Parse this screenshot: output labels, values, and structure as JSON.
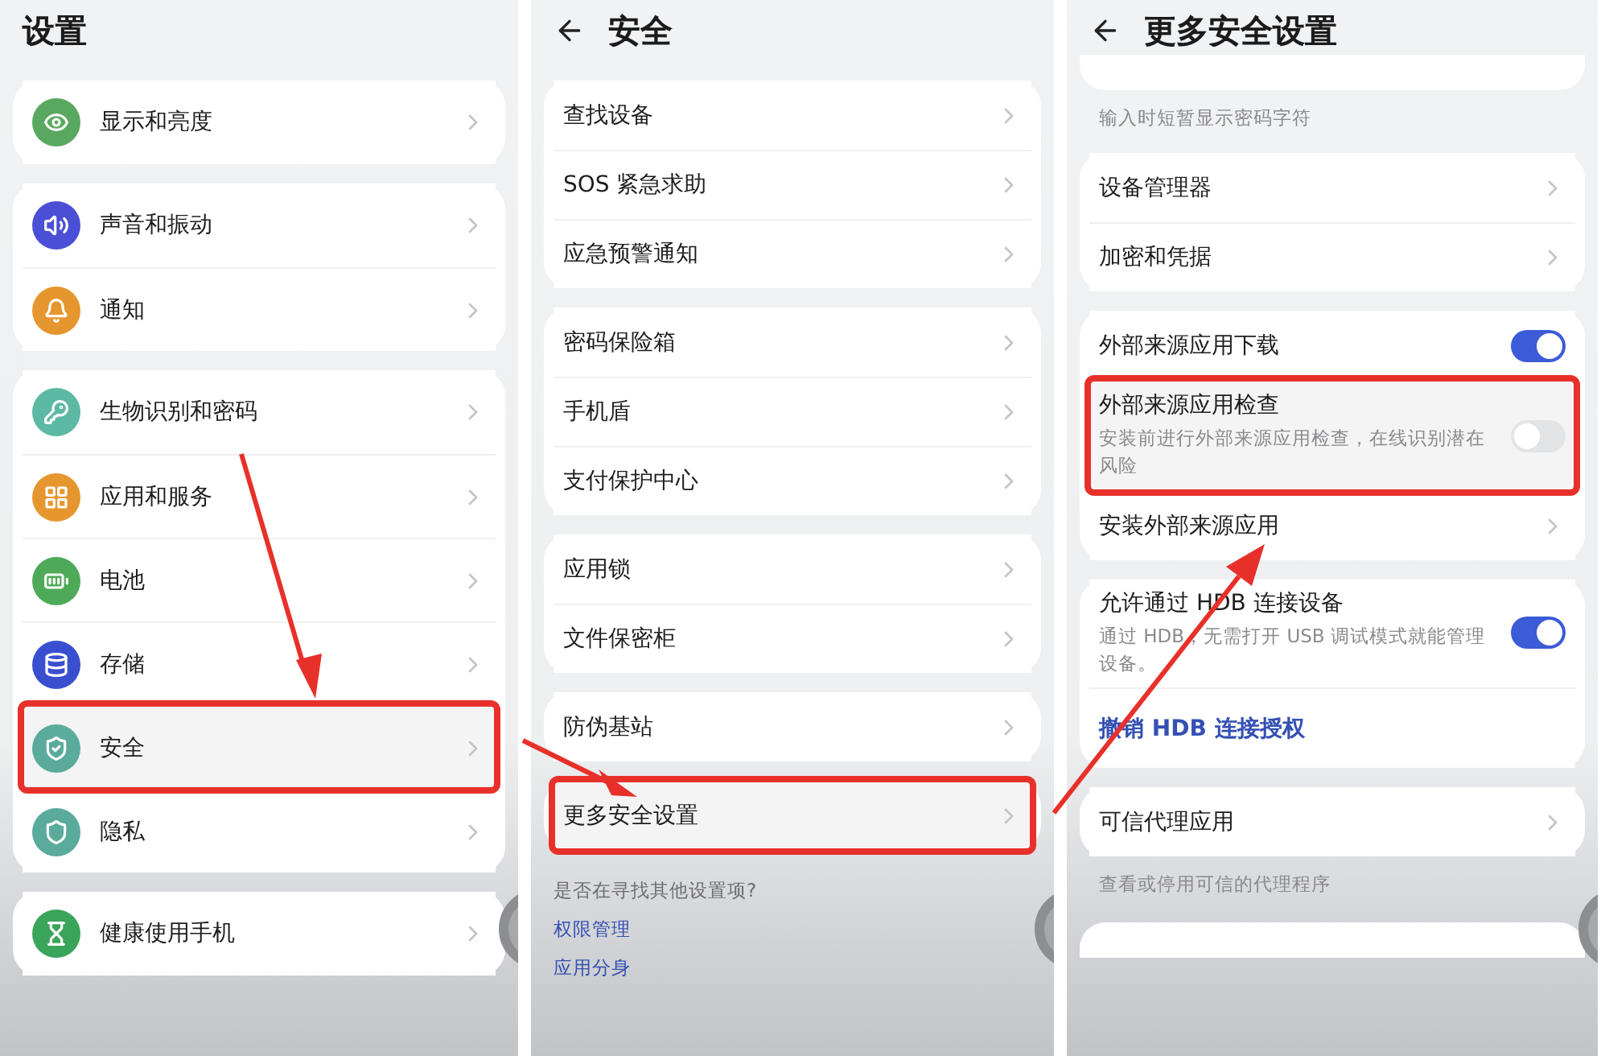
{
  "panels": [
    {
      "title": "设置",
      "back_button": false,
      "floating_button": true,
      "sections": [
        {
          "kind": "card",
          "items": [
            {
              "kind": "nav",
              "label": "显示和亮度",
              "color": "#5aa85f",
              "highlighted": false
            }
          ]
        },
        {
          "kind": "card",
          "items": [
            {
              "kind": "nav",
              "label": "声音和振动",
              "color": "#4b4fd6",
              "highlighted": false
            },
            {
              "kind": "nav",
              "label": "通知",
              "color": "#e6962e",
              "highlighted": false
            }
          ]
        },
        {
          "kind": "card",
          "items": [
            {
              "kind": "nav",
              "label": "生物识别和密码",
              "color": "#5cb9a3",
              "highlighted": false
            },
            {
              "kind": "nav",
              "label": "应用和服务",
              "color": "#e6962e",
              "highlighted": false
            },
            {
              "kind": "nav",
              "label": "电池",
              "color": "#4eaa58",
              "highlighted": false
            },
            {
              "kind": "nav",
              "label": "存储",
              "color": "#3a4fcf",
              "highlighted": false
            },
            {
              "kind": "nav",
              "label": "安全",
              "color": "#5aab9c",
              "highlighted": true
            },
            {
              "kind": "nav",
              "label": "隐私",
              "color": "#5aab9c",
              "highlighted": false
            }
          ]
        },
        {
          "kind": "card",
          "items": [
            {
              "kind": "nav",
              "label": "健康使用手机",
              "color": "#3aa55a",
              "highlighted": false
            }
          ]
        }
      ]
    },
    {
      "title": "安全",
      "back_button": true,
      "floating_button": true,
      "sections": [
        {
          "kind": "card",
          "items": [
            {
              "kind": "nav",
              "label": "查找设备",
              "highlighted": false
            },
            {
              "kind": "nav",
              "label": "SOS 紧急求助",
              "highlighted": false
            },
            {
              "kind": "nav",
              "label": "应急预警通知",
              "highlighted": false
            }
          ]
        },
        {
          "kind": "card",
          "items": [
            {
              "kind": "nav",
              "label": "密码保险箱",
              "highlighted": false
            },
            {
              "kind": "nav",
              "label": "手机盾",
              "highlighted": false
            },
            {
              "kind": "nav",
              "label": "支付保护中心",
              "highlighted": false
            }
          ]
        },
        {
          "kind": "card",
          "items": [
            {
              "kind": "nav",
              "label": "应用锁",
              "highlighted": false
            },
            {
              "kind": "nav",
              "label": "文件保密柜",
              "highlighted": false
            }
          ]
        },
        {
          "kind": "card",
          "items": [
            {
              "kind": "nav",
              "label": "防伪基站",
              "highlighted": false
            }
          ]
        },
        {
          "kind": "card",
          "items": [
            {
              "kind": "nav",
              "label": "更多安全设置",
              "highlighted": true
            }
          ]
        },
        {
          "kind": "footer",
          "question": "是否在寻找其他设置项?",
          "links": [
            "权限管理",
            "应用分身"
          ]
        }
      ]
    },
    {
      "title": "更多安全设置",
      "back_button": true,
      "floating_button": true,
      "sections": [
        {
          "kind": "cut-card"
        },
        {
          "kind": "note",
          "text": "输入时短暂显示密码字符"
        },
        {
          "kind": "card",
          "items": [
            {
              "kind": "nav",
              "label": "设备管理器",
              "highlighted": false
            },
            {
              "kind": "nav",
              "label": "加密和凭据",
              "highlighted": false
            }
          ]
        },
        {
          "kind": "card",
          "items": [
            {
              "kind": "toggle",
              "label": "外部来源应用下载",
              "on": true,
              "highlighted": false
            },
            {
              "kind": "toggle",
              "label": "外部来源应用检查",
              "description": "安装前进行外部来源应用检查，在线识别潜在风险",
              "on": false,
              "highlighted": true
            },
            {
              "kind": "nav",
              "label": "安装外部来源应用",
              "highlighted": false
            }
          ]
        },
        {
          "kind": "card",
          "items": [
            {
              "kind": "toggle",
              "label": "允许通过 HDB 连接设备",
              "description": "通过 HDB，无需打开 USB 调试模式就能管理设备。",
              "on": true,
              "highlighted": false
            },
            {
              "kind": "link",
              "label": "撤销 HDB 连接授权",
              "highlighted": false
            }
          ]
        },
        {
          "kind": "card",
          "items": [
            {
              "kind": "nav",
              "label": "可信代理应用",
              "highlighted": false
            }
          ]
        },
        {
          "kind": "note",
          "text": "查看或停用可信的代理程序"
        },
        {
          "kind": "cut-card"
        }
      ]
    }
  ]
}
